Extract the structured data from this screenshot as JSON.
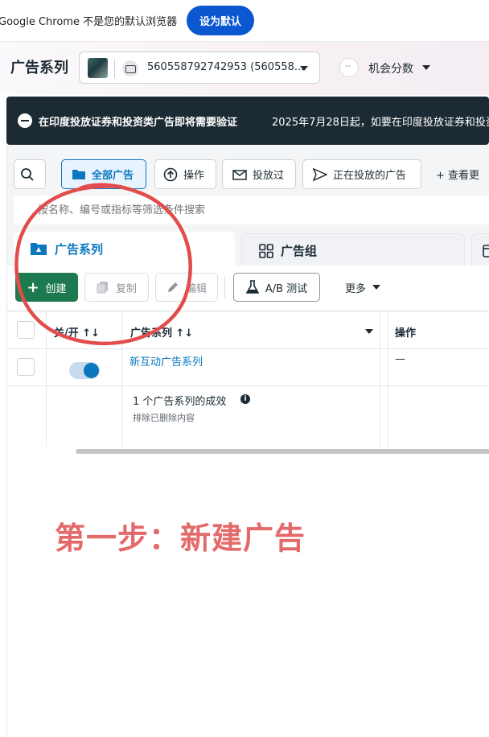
{
  "chrome_bar": {
    "message": "Google Chrome 不是您的默认浏览器",
    "set_default_label": "设为默认"
  },
  "header": {
    "title": "广告系列",
    "account_id": "560558792742953 (560558...",
    "opportunity_score_label": "机会分数",
    "opportunity_score_value": "--"
  },
  "banner": {
    "title": "在印度投放证券和投资类广告即将需要验证",
    "body": "2025年7月28日起，如要在印度投放证券和投资"
  },
  "toolbar": {
    "all_ads_label": "全部广告",
    "operations_label": "操作",
    "delivered_label": "投放过",
    "active_label": "正在投放的广告",
    "more_views_label": "+ 查看更"
  },
  "search": {
    "placeholder": "按名称、编号或指标等筛选条件搜索"
  },
  "tabs": [
    {
      "label": "广告系列",
      "active": true
    },
    {
      "label": "广告组",
      "active": false
    },
    {
      "label": "",
      "active": false
    }
  ],
  "actions": {
    "create_label": "创建",
    "copy_label": "复制",
    "edit_label": "编辑",
    "ab_test_label": "A/B 测试",
    "more_label": "更多"
  },
  "table": {
    "columns": [
      "关/开 ↑↓",
      "广告系列 ↑↓",
      "操作"
    ],
    "rows": [
      {
        "name": "新互动广告系列",
        "enabled": true,
        "operation": "—"
      }
    ],
    "summary_title": "1 个广告系列的成效",
    "summary_subtitle": "排除已删除内容"
  },
  "annotation": {
    "step_text": "第一步：新建广告",
    "color": "#e24c4c"
  },
  "colors": {
    "accent_blue": "#0a78be",
    "create_green": "#1d7a4f",
    "banner_dark": "#1c2b33"
  }
}
